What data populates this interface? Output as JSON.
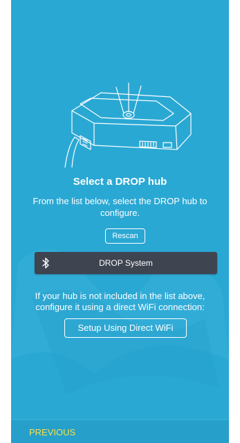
{
  "screen": {
    "title": "Select a DROP hub",
    "subtitle": "From the list below, select the DROP hub to configure.",
    "rescan_label": "Rescan",
    "device_list": [
      {
        "icon": "bluetooth-icon",
        "label": "DROP System"
      }
    ],
    "note": "If your hub is not included in the list above, configure it using a direct WiFi connection:",
    "direct_wifi_label": "Setup Using Direct WiFi"
  },
  "footer": {
    "previous_label": "PREVIOUS"
  },
  "colors": {
    "background": "#2aa8d4",
    "device_row": "#3e4450",
    "previous_text": "#f5e04a",
    "text": "#ffffff"
  }
}
